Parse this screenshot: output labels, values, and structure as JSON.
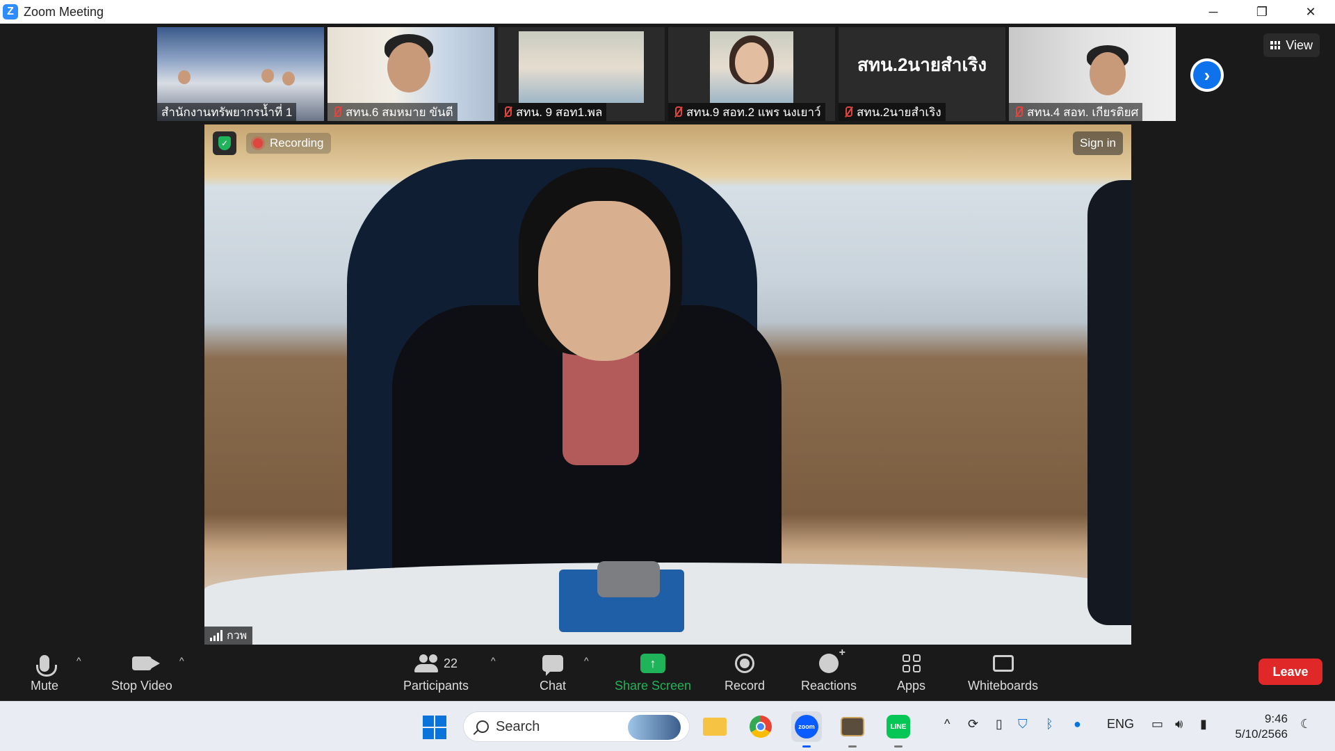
{
  "window": {
    "title": "Zoom Meeting",
    "app_icon": "zoom-logo-icon"
  },
  "window_controls": {
    "minimize": "─",
    "restore": "❐",
    "close": "✕"
  },
  "thumbnails": [
    {
      "name": "สำนักงานทรัพยากรน้ำที่ 1",
      "muted": false
    },
    {
      "name": "สทน.6 สมหมาย  ขันตี",
      "muted": true
    },
    {
      "name": "สทน. 9 สอท1.พล",
      "muted": true
    },
    {
      "name": "สทน.9 สอท.2 แพร นงเยาว์",
      "muted": true
    },
    {
      "name": "สทน.2นายสำเริง",
      "muted": true,
      "text_avatar": "สทน.2นายสำเริง"
    },
    {
      "name": "สทน.4 สอท. เกียรติยศ",
      "muted": true
    }
  ],
  "view_button": {
    "label": "View"
  },
  "main_video": {
    "recording_label": "Recording",
    "sign_in_label": "Sign in",
    "speaker_name": "กวพ"
  },
  "toolbar": {
    "mute": "Mute",
    "stop_video": "Stop Video",
    "participants": "Participants",
    "participants_count": "22",
    "chat": "Chat",
    "share_screen": "Share Screen",
    "record": "Record",
    "reactions": "Reactions",
    "apps": "Apps",
    "whiteboards": "Whiteboards",
    "leave": "Leave"
  },
  "taskbar": {
    "search_label": "Search",
    "tray_language": "ENG",
    "time": "9:46",
    "date": "5/10/2566"
  },
  "colors": {
    "share_green": "#1fb35a",
    "leave_red": "#e02828",
    "zoom_blue": "#0e72ed",
    "recording_red": "#e0453e"
  }
}
